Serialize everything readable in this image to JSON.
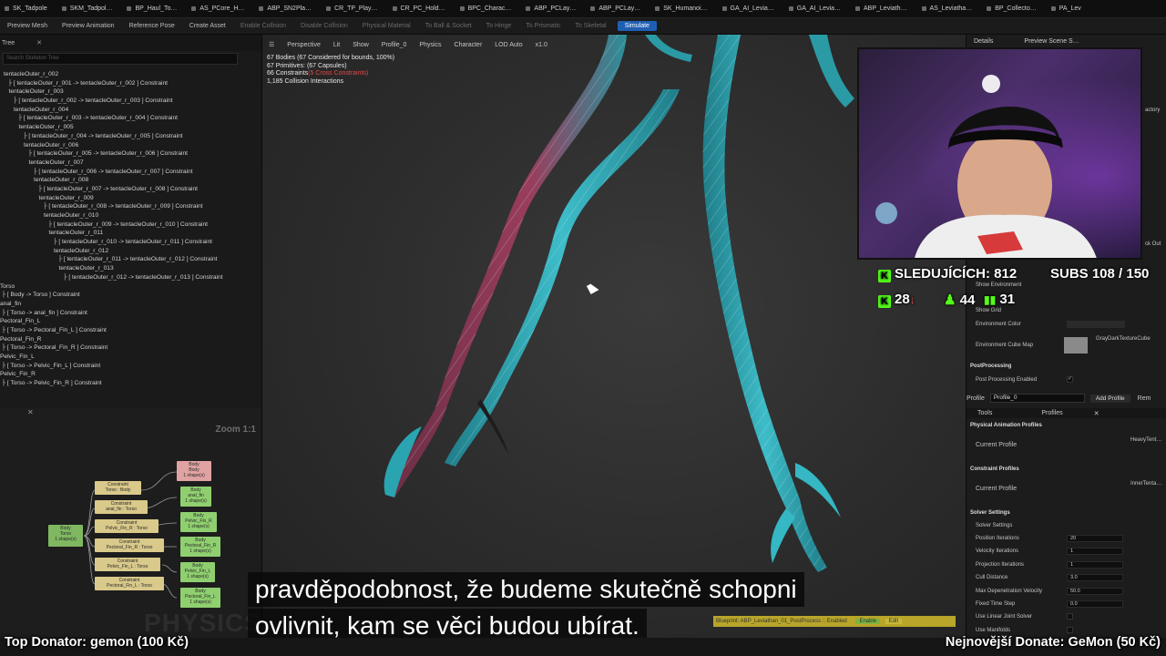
{
  "tabs": [
    "SK_Tadpole",
    "SKM_Tadpol…",
    "BP_Haul_To…",
    "AS_PCore_H…",
    "ABP_SN2Pla…",
    "CR_TP_Play…",
    "CR_PC_Hold…",
    "BPC_Charac…",
    "ABP_PCLay…",
    "ABP_PCLay…",
    "SK_Humanoi…",
    "GA_AI_Levia…",
    "GA_AI_Levia…",
    "ABP_Leviath…",
    "AS_Leviatha…",
    "BP_Collecto…",
    "PA_Lev"
  ],
  "toolbar": {
    "preview_mesh": "Preview Mesh",
    "preview_animation": "Preview Animation",
    "reference_pose": "Reference Pose",
    "create_asset": "Create Asset",
    "enable_collision": "Enable Collision",
    "disable_collision": "Disable Collision",
    "physical_material": "Physical Material",
    "to_ball_socket": "To Ball & Socket",
    "to_hinge": "To Hinge",
    "to_prismatic": "To Prismatic",
    "to_skeletal": "To Skeletal",
    "simulate": "Simulate"
  },
  "left_panel": {
    "title": "Tree",
    "search_placeholder": "Search Skeleton Tree",
    "rows": [
      "tentacleOuter_r_002",
      "[ tentacleOuter_r_001 -> tentacleOuter_r_002 ] Constraint",
      "tentacleOuter_r_003",
      "[ tentacleOuter_r_002 -> tentacleOuter_r_003 ] Constraint",
      "tentacleOuter_r_004",
      "[ tentacleOuter_r_003 -> tentacleOuter_r_004 ] Constraint",
      "tentacleOuter_r_005",
      "[ tentacleOuter_r_004 -> tentacleOuter_r_005 ] Constraint",
      "tentacleOuter_r_006",
      "[ tentacleOuter_r_005 -> tentacleOuter_r_006 ] Constraint",
      "tentacleOuter_r_007",
      "[ tentacleOuter_r_006 -> tentacleOuter_r_007 ] Constraint",
      "tentacleOuter_r_008",
      "[ tentacleOuter_r_007 -> tentacleOuter_r_008 ] Constraint",
      "tentacleOuter_r_009",
      "[ tentacleOuter_r_008 -> tentacleOuter_r_009 ] Constraint",
      "tentacleOuter_r_010",
      "[ tentacleOuter_r_009 -> tentacleOuter_r_010 ] Constraint",
      "tentacleOuter_r_011",
      "[ tentacleOuter_r_010 -> tentacleOuter_r_011 ] Constraint",
      "tentacleOuter_r_012",
      "[ tentacleOuter_r_011 -> tentacleOuter_r_012 ] Constraint",
      "tentacleOuter_r_013",
      "[ tentacleOuter_r_012 -> tentacleOuter_r_013 ] Constraint",
      "Torso",
      "[ Body -> Torso ] Constraint",
      "anal_fin",
      "[ Torso -> anal_fin ] Constraint",
      "Pectoral_Fin_L",
      "[ Torso -> Pectoral_Fin_L ] Constraint",
      "Pectoral_Fin_R",
      "[ Torso -> Pectoral_Fin_R ] Constraint",
      "Pelvic_Fin_L",
      "[ Torso -> Pelvic_Fin_L ] Constraint",
      "Pelvic_Fin_R",
      "[ Torso -> Pelvic_Fin_R ] Constraint"
    ]
  },
  "graph": {
    "zoom": "Zoom 1:1",
    "watermark": "PHYSICS",
    "nodes": {
      "body_root": "Body\nTorso\n1 shape(s)",
      "c1": "Constraint\nTorso : Body",
      "c2": "Constraint\nanal_fin : Torso",
      "c3": "Constraint\nPelvic_Fin_R : Torso",
      "c4": "Constraint\nPectoral_Fin_R : Torso",
      "c5": "Constraint\nPelvic_Fin_L : Torso",
      "c6": "Constraint\nPectoral_Fin_L : Torso",
      "s0": "Body\nBody\n1 shape(s)",
      "s1": "Body\nanal_fin\n1 shape(s)",
      "s2": "Body\nPelvic_Fin_R\n1 shape(s)",
      "s3": "Body\nPectoral_Fin_R\n1 shape(s)",
      "s4": "Body\nPelvic_Fin_L\n1 shape(s)",
      "s5": "Body\nPectoral_Fin_L\n1 shape(s)"
    }
  },
  "viewport": {
    "perspective": "Perspective",
    "lit": "Lit",
    "show": "Show",
    "profile": "Profile_0",
    "physics": "Physics",
    "character": "Character",
    "lod": "LOD Auto",
    "speed": "x1.0",
    "stats": [
      "67 Bodies (67 Considered for bounds, 100%)",
      "67 Primitives: (67 Capsules)",
      "66 Constraints(5 Cross Constraints)",
      "1,185 Collision Interactions"
    ],
    "warn_text": "(5 Cross Constraints)"
  },
  "right_panel": {
    "details": "Details",
    "preview_scene": "Preview Scene S…",
    "show_environment": "Show Environment",
    "show_grid": "Show Grid",
    "environment_color": "Environment Color",
    "environment_cube_map": "Environment Cube Map",
    "cube_map_value": "GrayDarkTextureCube",
    "post_processing": "PostProcessing",
    "post_processing_enabled": "Post Processing Enabled",
    "profile_label": "Profile",
    "profile_value": "Profile_0",
    "add_profile": "Add Profile",
    "remove": "Rem",
    "tools_tab": "Tools",
    "profiles_tab": "Profiles",
    "physical_animation_profiles": "Physical Animation Profiles",
    "current_profile_1": "Current Profile",
    "current_profile_1_value": "HeavyTent…",
    "constraint_profiles": "Constraint Profiles",
    "current_profile_2": "Current Profile",
    "current_profile_2_value": "InnerTenta…",
    "solver_settings_section": "Solver Settings",
    "solver_settings": "Solver Settings",
    "solver": [
      {
        "label": "Position Iterations",
        "value": "20"
      },
      {
        "label": "Velocity Iterations",
        "value": "1"
      },
      {
        "label": "Projection Iterations",
        "value": "1"
      },
      {
        "label": "Cull Distance",
        "value": "3.0"
      },
      {
        "label": "Max Depenetration Velocity",
        "value": "50.0"
      },
      {
        "label": "Fixed Time Step",
        "value": "0.0"
      },
      {
        "label": "Use Linear Joint Solver",
        "value": ""
      },
      {
        "label": "Use Manifolds",
        "value": ""
      }
    ],
    "other_labels": [
      "actory",
      "ck Out"
    ]
  },
  "overlay": {
    "followers": "SLEDUJÍCÍCH: 812",
    "subs": "SUBS 108 / 150",
    "kick_count": "28",
    "viewers": "44",
    "chart_count": "31"
  },
  "subtitles": [
    "pravděpodobnost, že budeme skutečně schopni",
    "ovlivnit, kam se věci budou ubírat."
  ],
  "status_strip": "Blueprint: ABP_Leviathan_01_PostProcess :: Enabled",
  "status_strip_extra": "Enable",
  "status_strip_edit": "Edit",
  "donators": {
    "top": "Top Donator: gemon (100 Kč)",
    "latest": "Nejnovější Donate: GeMon (50 Kč)"
  },
  "colors": {
    "tentacle": "#35b7c4",
    "simulate": "#1f5fb3",
    "kick_green": "#53fc18",
    "warn": "#e34b4b"
  }
}
